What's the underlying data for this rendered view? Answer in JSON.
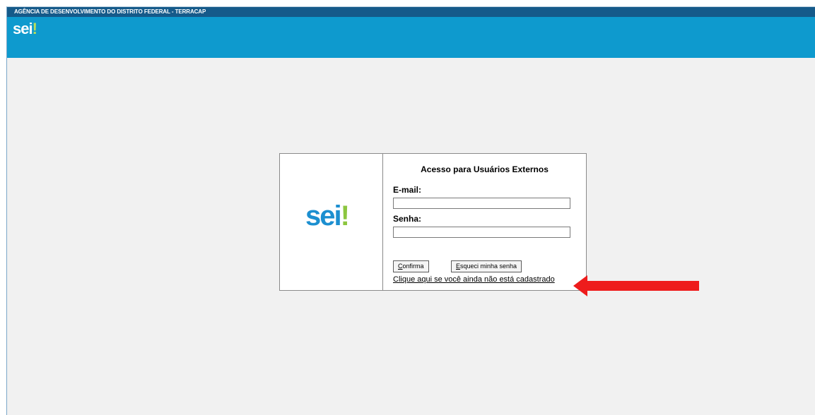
{
  "header": {
    "agency": "AGÊNCIA DE DESENVOLVIMENTO DO DISTRITO FEDERAL - TERRACAP",
    "logo_text": "sei",
    "logo_excl": "!"
  },
  "login": {
    "logo_text": "sei",
    "logo_excl": "!",
    "title": "Acesso para Usuários Externos",
    "email_label": "E-mail:",
    "email_value": "",
    "password_label": "Senha:",
    "password_value": "",
    "confirm_first": "C",
    "confirm_rest": "onfirma",
    "forgot_first": "E",
    "forgot_rest": "squeci minha senha",
    "register_link": "Clique aqui se você ainda não está cadastrado"
  },
  "colors": {
    "topbar": "#155a8a",
    "banner": "#0e9ace",
    "logo_blue": "#1c8fd0",
    "logo_green": "#8cc63f",
    "arrow": "#ee1c1c"
  }
}
